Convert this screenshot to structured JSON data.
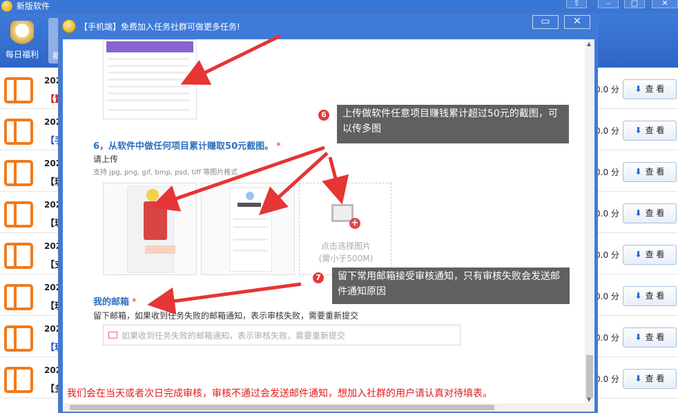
{
  "app": {
    "title": "新版软件"
  },
  "toolbar": {
    "fuli_label": "每日福利",
    "new_label": "新"
  },
  "rows": [
    {
      "year": "202",
      "tag": "【置",
      "tag_color": "#cc1111",
      "score": "0.0 分",
      "view": "查 看"
    },
    {
      "year": "202",
      "tag": "【手",
      "tag_color": "#2255cc",
      "score": "0.0 分",
      "view": "查 看"
    },
    {
      "year": "202",
      "tag": "【玩",
      "tag_color": "#222222",
      "score": "0.0 分",
      "view": "查 看"
    },
    {
      "year": "202",
      "tag": "【玩",
      "tag_color": "#222222",
      "score": "0.0 分",
      "view": "查 看"
    },
    {
      "year": "202",
      "tag": "【支",
      "tag_color": "#222222",
      "score": "0.0 分",
      "view": "查 看"
    },
    {
      "year": "202",
      "tag": "【玩",
      "tag_color": "#222222",
      "score": "0.0 分",
      "view": "查 看"
    },
    {
      "year": "202",
      "tag": "【玩",
      "tag_color": "#2255cc",
      "score": "0.0 分",
      "view": "查 看"
    },
    {
      "year": "202",
      "tag": "【多",
      "tag_color": "#222222",
      "score": "0.0 分",
      "view": "查 看"
    }
  ],
  "dialog": {
    "title": "【手机端】免费加入任务社群可做更多任务!",
    "q6": {
      "label": "6，从软件中做任何项目累计赚取50元截图。",
      "required": "*",
      "upload": "请上传",
      "formats": "支持 jpg, png, gif, bmp, psd, tiff 等图片格式",
      "pick_line1": "点击选择图片",
      "pick_line2": "(需小于500M)"
    },
    "q7": {
      "label": "我的邮箱",
      "required": "*",
      "hint": "留下邮箱，如果收到任务失败的邮箱通知，表示审核失败，需要重新提交",
      "placeholder": "如果收到任务失败的邮箱通知，表示审核失败，需要重新提交"
    },
    "notice": "我们会在当天或者次日完成审核，审核不通过会发送邮件通知，想加入社群的用户请认真对待填表。",
    "callout6": {
      "num": "6",
      "text": "上传做软件任意项目赚钱累计超过50元的截图，可以传多图"
    },
    "callout7": {
      "num": "7",
      "text": "留下常用邮箱接受审核通知，只有审核失败会发送邮件通知原因"
    }
  },
  "colors": {
    "accent": "#3f7ad8",
    "arrow": "#e53535",
    "callout_bg": "#606060"
  }
}
